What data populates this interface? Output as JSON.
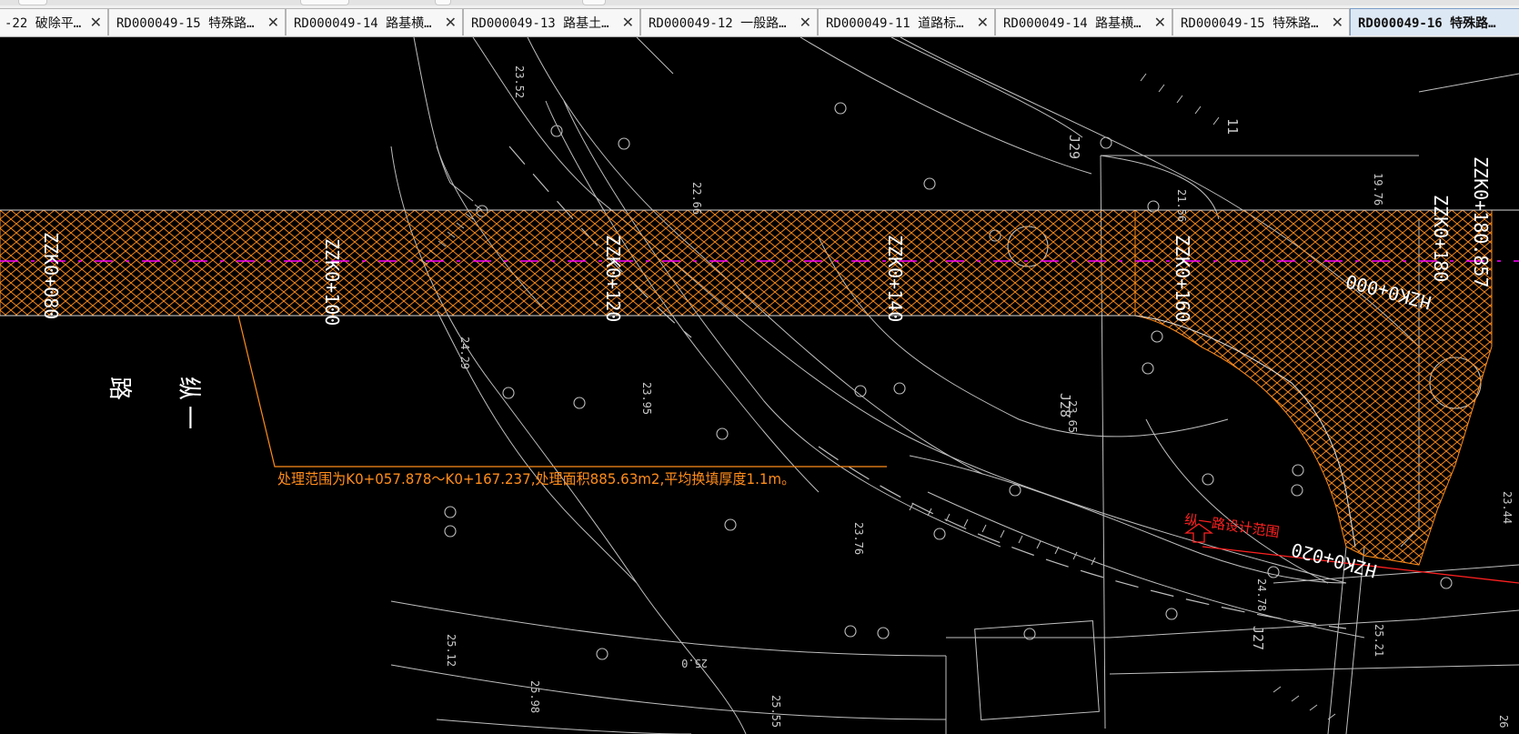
{
  "tabs": [
    {
      "label": "-22 破除平…",
      "active": false
    },
    {
      "label": "RD000049-15 特殊路…",
      "active": false
    },
    {
      "label": "RD000049-14 路基横…",
      "active": false
    },
    {
      "label": "RD000049-13 路基土…",
      "active": false
    },
    {
      "label": "RD000049-12 一般路…",
      "active": false
    },
    {
      "label": "RD000049-11 道路标…",
      "active": false
    },
    {
      "label": "RD000049-14 路基横…",
      "active": false
    },
    {
      "label": "RD000049-15 特殊路…",
      "active": false
    },
    {
      "label": "RD000049-16 特殊路…",
      "active": true
    }
  ],
  "close_glyph": "✕",
  "drawing": {
    "annotation": "处理范围为K0+057.878～K0+167.237,处理面积885.63m2,平均换填厚度1.1m。",
    "red_label": "纵一路设计范围",
    "road_name": [
      "纵",
      "一",
      "路"
    ],
    "stations": [
      "ZZK0+080",
      "ZZK0+100",
      "ZZK0+120",
      "ZZK0+140",
      "ZZK0+160",
      "ZZK0+180",
      "ZZK0+180.857",
      "HZK0+000",
      "HZK0+020"
    ],
    "elevations": [
      "23.52",
      "22.66",
      "24.29",
      "23.95",
      "23.76",
      "25.12",
      "25.98",
      "25.0",
      "25.55",
      "21.56",
      "19.76",
      "23.65",
      "24.78",
      "25.21",
      "23.44",
      "26"
    ],
    "point_ids": [
      "J29",
      "J28",
      "J27",
      "11"
    ],
    "colors": {
      "hatch": "#ff8c1a",
      "centerline": "#ff00ff",
      "linework": "#bfbfbf",
      "red": "#ff2020",
      "background": "#000000"
    }
  }
}
